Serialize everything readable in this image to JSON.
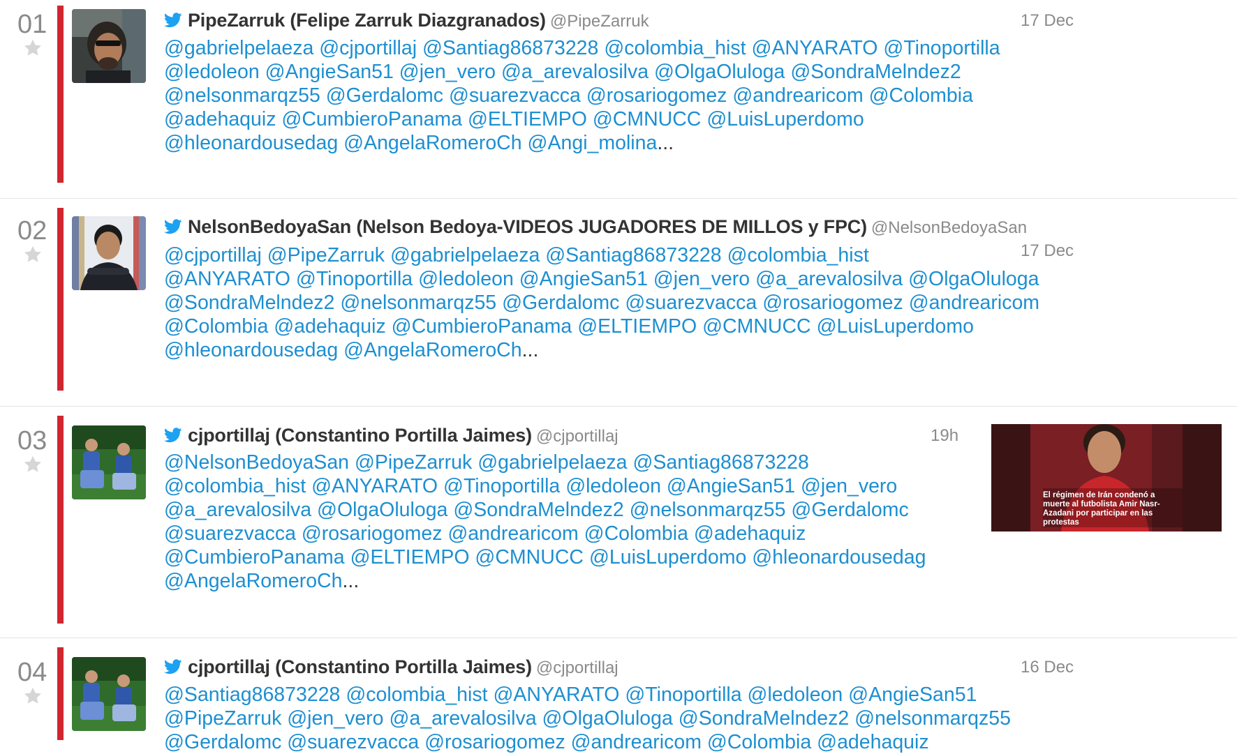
{
  "tweets": [
    {
      "rank": "01",
      "author": "PipeZarruk (Felipe Zarruk Diazgranados)",
      "handle": "@PipeZarruk",
      "time": "17 Dec",
      "lines": [
        [
          "@gabrielpelaeza",
          "@cjportillaj",
          "@Santiag86873228",
          "@colombia_hist",
          "@ANYARATO",
          "@Tinoportilla"
        ],
        [
          "@ledoleon",
          "@AngieSan51",
          "@jen_vero",
          "@a_arevalosilva",
          "@OlgaOluloga",
          "@SondraMelndez2"
        ],
        [
          "@nelsonmarqz55",
          "@Gerdalomc",
          "@suarezvacca",
          "@rosariogomez",
          "@andrearicom",
          "@Colombia"
        ],
        [
          "@adehaquiz",
          "@CumbieroPanama",
          "@ELTIEMPO",
          "@CMNUCC",
          "@LuisLuperdomo"
        ],
        [
          "@hleonardousedag",
          "@AngelaRomeroCh",
          "@Angi_molina"
        ]
      ],
      "ellipsis": "..."
    },
    {
      "rank": "02",
      "author": "NelsonBedoyaSan (Nelson Bedoya-VIDEOS JUGADORES DE MILLOS y FPC)",
      "handle": "@NelsonBedoyaSan",
      "time": "17 Dec",
      "lines": [
        [
          "@cjportillaj",
          "@PipeZarruk",
          "@gabrielpelaeza",
          "@Santiag86873228",
          "@colombia_hist"
        ],
        [
          "@ANYARATO",
          "@Tinoportilla",
          "@ledoleon",
          "@AngieSan51",
          "@jen_vero",
          "@a_arevalosilva",
          "@OlgaOluloga"
        ],
        [
          "@SondraMelndez2",
          "@nelsonmarqz55",
          "@Gerdalomc",
          "@suarezvacca",
          "@rosariogomez",
          "@andrearicom"
        ],
        [
          "@Colombia",
          "@adehaquiz",
          "@CumbieroPanama",
          "@ELTIEMPO",
          "@CMNUCC",
          "@LuisLuperdomo"
        ],
        [
          "@hleonardousedag",
          "@AngelaRomeroCh"
        ]
      ],
      "ellipsis": "..."
    },
    {
      "rank": "03",
      "author": "cjportillaj (Constantino Portilla Jaimes)",
      "handle": "@cjportillaj",
      "time": "19h",
      "lines": [
        [
          "@NelsonBedoyaSan",
          "@PipeZarruk",
          "@gabrielpelaeza",
          "@Santiag86873228"
        ],
        [
          "@colombia_hist",
          "@ANYARATO",
          "@Tinoportilla",
          "@ledoleon",
          "@AngieSan51",
          "@jen_vero"
        ],
        [
          "@a_arevalosilva",
          "@OlgaOluloga",
          "@SondraMelndez2",
          "@nelsonmarqz55",
          "@Gerdalomc"
        ],
        [
          "@suarezvacca",
          "@rosariogomez",
          "@andrearicom",
          "@Colombia",
          "@adehaquiz"
        ],
        [
          "@CumbieroPanama",
          "@ELTIEMPO",
          "@CMNUCC",
          "@LuisLuperdomo",
          "@hleonardousedag"
        ],
        [
          "@AngelaRomeroCh"
        ]
      ],
      "ellipsis": "...",
      "media": {
        "caption": "El régimen de Irán condenó a muerte al futbolista Amir Nasr-Azadani por participar en las protestas"
      }
    },
    {
      "rank": "04",
      "author": "cjportillaj (Constantino Portilla Jaimes)",
      "handle": "@cjportillaj",
      "time": "16 Dec",
      "lines": [
        [
          "@Santiag86873228",
          "@colombia_hist",
          "@ANYARATO",
          "@Tinoportilla",
          "@ledoleon",
          "@AngieSan51"
        ],
        [
          "@PipeZarruk",
          "@jen_vero",
          "@a_arevalosilva",
          "@OlgaOluloga",
          "@SondraMelndez2",
          "@nelsonmarqz55"
        ],
        [
          "@Gerdalomc",
          "@suarezvacca",
          "@rosariogomez",
          "@andrearicom",
          "@Colombia",
          "@adehaquiz"
        ]
      ],
      "ellipsis": ""
    }
  ],
  "colors": {
    "link": "#1d8fd1",
    "author": "#333333",
    "muted": "#8a8a8a",
    "rank_bar": "#d0262f",
    "twitter_bird": "#1da1f2",
    "separator": "#e3e3e3"
  },
  "icons": {
    "bird": "twitter-bird-icon",
    "star": "star-icon"
  }
}
